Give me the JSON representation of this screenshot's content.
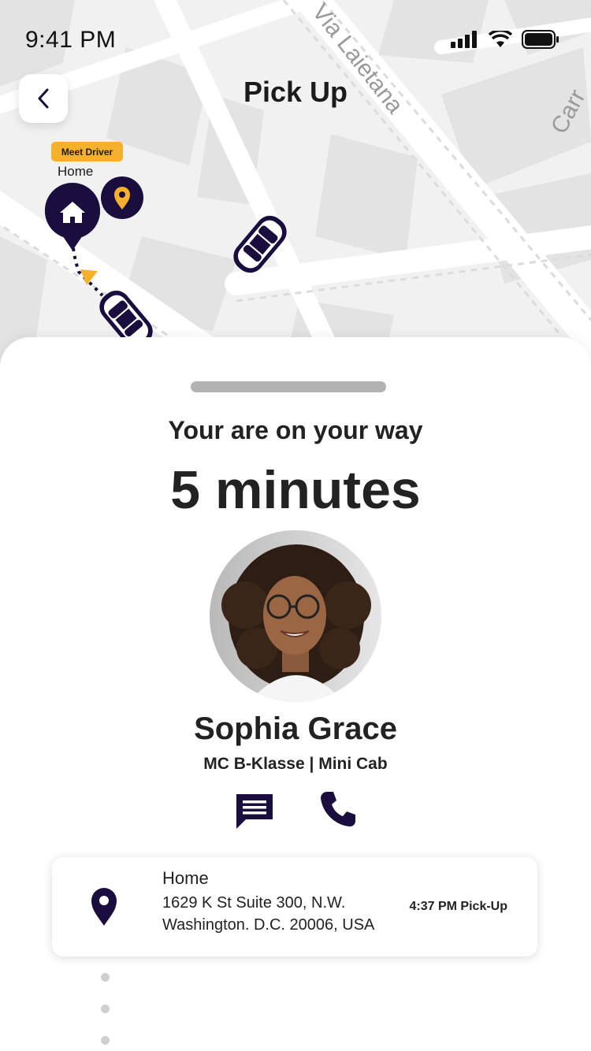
{
  "status_bar": {
    "time": "9:41 PM",
    "signal_icon": "cellular-signal-icon",
    "wifi_icon": "wifi-icon",
    "battery_icon": "battery-icon"
  },
  "header": {
    "title": "Pick Up",
    "back_icon": "chevron-left-icon"
  },
  "map": {
    "street_labels": [
      "Via Laietana",
      "Carr"
    ],
    "meet_driver_badge": "Meet Driver",
    "home_marker_label": "Home",
    "accent_color": "#f6b12c",
    "marker_color": "#1a0e3f"
  },
  "trip": {
    "status_text": "Your are on your way",
    "eta": "5 minutes"
  },
  "driver": {
    "name": "Sophia Grace",
    "vehicle": "MC B-Klasse | Mini Cab",
    "message_icon": "chat-message-icon",
    "call_icon": "phone-icon"
  },
  "pickup": {
    "title": "Home",
    "address_line1": "1629 K St Suite 300, N.W.",
    "address_line2": "Washington. D.C. 20006, USA",
    "time": "4:37 PM Pick-Up",
    "icon": "location-pin-icon"
  }
}
